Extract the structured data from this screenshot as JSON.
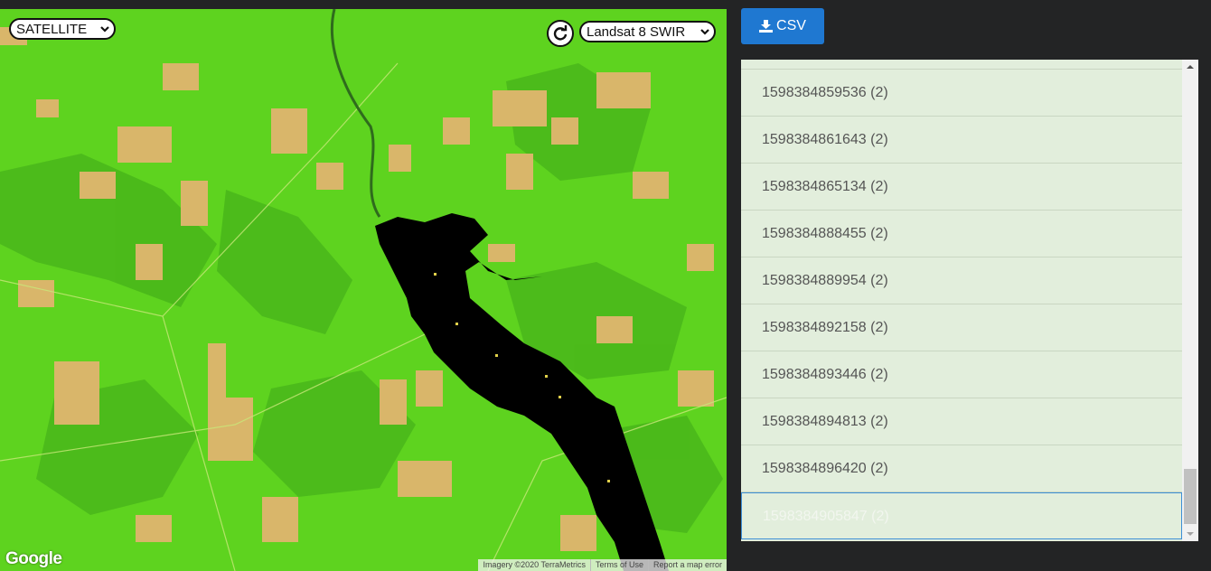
{
  "map": {
    "map_type": "SATELLITE",
    "layer": "Landsat 8 SWIR",
    "google_logo": "Google",
    "attribution": {
      "imagery": "Imagery ©2020 TerraMetrics",
      "terms": "Terms of Use",
      "report": "Report a map error"
    }
  },
  "toolbar": {
    "csv_label": "CSV"
  },
  "list": {
    "items": [
      {
        "label": "1598384859536 (2)"
      },
      {
        "label": "1598384861643 (2)"
      },
      {
        "label": "1598384865134 (2)"
      },
      {
        "label": "1598384888455 (2)"
      },
      {
        "label": "1598384889954 (2)"
      },
      {
        "label": "1598384892158 (2)"
      },
      {
        "label": "1598384893446 (2)"
      },
      {
        "label": "1598384894813 (2)"
      },
      {
        "label": "1598384896420 (2)"
      },
      {
        "label": "1598384905847 (2)",
        "selected": true
      }
    ]
  },
  "colors": {
    "background": "#232425",
    "map_vegetation": "#5ed31f",
    "water": "#000000",
    "button": "#1f78d1",
    "list_bg": "#e2eedc",
    "selected_border": "#3d8fd6"
  },
  "icons": [
    "chevron-down-icon",
    "refresh-icon",
    "download-icon"
  ]
}
